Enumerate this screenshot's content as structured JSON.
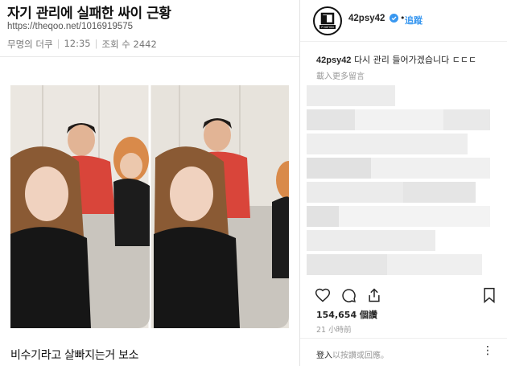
{
  "post": {
    "title": "자기 관리에 실패한 싸이 근황",
    "url": "https://theqoo.net/1016919575",
    "author": "무명의 더쿠",
    "time": "12:35",
    "views": "조회 수 2442",
    "caption": "비수기라고 살빠지는거 보소"
  },
  "instagram": {
    "logo_text": "P NATION",
    "username": "42psy42",
    "follow_label": "追蹤",
    "comment_user": "42psy42",
    "comment_text": "다시 관리 들어가겠습니다 ㄷㄷㄷ",
    "translate_label": "載入更多留言",
    "likes": "154,654 個讚",
    "time_ago": "21 小時前",
    "login_link": "登入",
    "login_rest": "以按讚或回應。",
    "more_label": "⋮",
    "icons": [
      "heart-icon",
      "comment-icon",
      "share-icon",
      "bookmark-icon",
      "verified-icon"
    ],
    "colors": {
      "accent": "#3897f0",
      "text": "#262626",
      "muted": "#999999"
    }
  }
}
